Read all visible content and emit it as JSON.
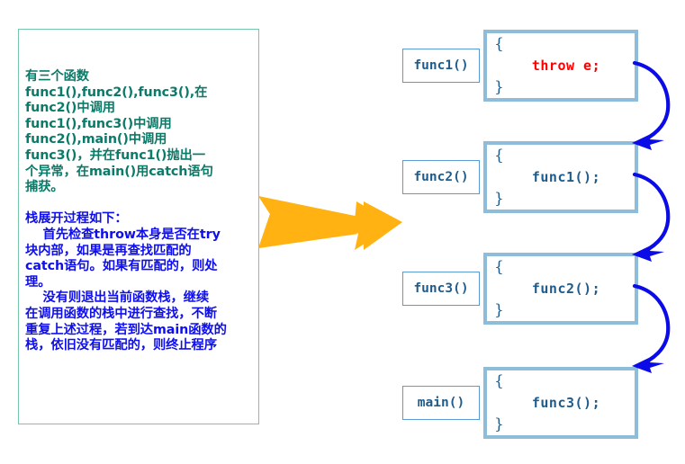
{
  "diagram": {
    "title_note": "C++ exception stack unwinding illustration",
    "colors": {
      "notes_border": "#76C6AC",
      "notes_text_teal": "#0B7A68",
      "notes_text_blue": "#0F0FEE",
      "flow_arrow": "#FFB212",
      "label_border": "#5B9BD5",
      "label_text": "#1F5C8B",
      "code_border": "#8DBDD8",
      "code_text": "#1F5C8B",
      "throw_text": "#FF0000",
      "unwind_arrow": "#0B0BE8"
    }
  },
  "notes": {
    "paragraph_1": "有三个函数\nfunc1(),func2(),func3(),在\nfunc2()中调用\nfunc1(),func3()中调用\nfunc2(),main()中调用\nfunc3()，并在func1()抛出一\n个异常，在main()用catch语句\n捕获。",
    "paragraph_2": "栈展开过程如下：\n    首先检查throw本身是否在try\n块内部，如果是再查找匹配的\ncatch语句。如果有匹配的，则处\n理。\n    没有则退出当前函数栈，继续\n在调用函数的栈中进行查找，不断\n重复上述过程，若到达main函数的\n栈，依旧没有匹配的，则终止程序"
  },
  "flow": {
    "arrow_icon": "right-block-arrow"
  },
  "stack": {
    "brace_open": "{",
    "brace_close": "}",
    "frames": [
      {
        "name": "func1()",
        "statement": "throw e;",
        "kind": "throw"
      },
      {
        "name": "func2()",
        "statement": "func1();",
        "kind": "call"
      },
      {
        "name": "func3()",
        "statement": "func2();",
        "kind": "call"
      },
      {
        "name": "main()",
        "statement": "func3();",
        "kind": "call"
      }
    ],
    "unwind_icon": "curved-down-arrow"
  }
}
